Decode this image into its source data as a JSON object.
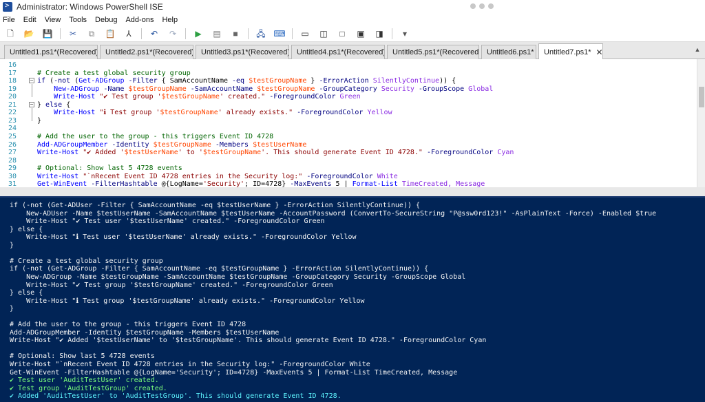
{
  "window": {
    "title": "Administrator: Windows PowerShell ISE"
  },
  "menu": [
    "File",
    "Edit",
    "View",
    "Tools",
    "Debug",
    "Add-ons",
    "Help"
  ],
  "toolbar": {
    "buttons": [
      {
        "name": "new-icon",
        "glyph": "🗋",
        "color": "#2a2a2a"
      },
      {
        "name": "open-icon",
        "glyph": "📂",
        "color": "#c99a2e"
      },
      {
        "name": "save-icon",
        "glyph": "💾",
        "color": "#1f4e9c"
      },
      {
        "name": "cut-icon",
        "glyph": "✂",
        "color": "#3a5fa8"
      },
      {
        "name": "copy-icon",
        "glyph": "⧉",
        "color": "#888888"
      },
      {
        "name": "paste-icon",
        "glyph": "📋",
        "color": "#555555"
      },
      {
        "name": "clear-icon",
        "glyph": "⅄",
        "color": "#2a2a2a"
      },
      {
        "name": "undo-icon",
        "glyph": "↶",
        "color": "#1f4e9c"
      },
      {
        "name": "redo-icon",
        "glyph": "↷",
        "color": "#9aa7bd"
      },
      {
        "name": "run-icon",
        "glyph": "▶",
        "color": "#2ea043"
      },
      {
        "name": "run-selection-icon",
        "glyph": "▤",
        "color": "#777777"
      },
      {
        "name": "stop-icon",
        "glyph": "■",
        "color": "#666666"
      },
      {
        "name": "remote-icon",
        "glyph": "🖧",
        "color": "#1f4e9c"
      },
      {
        "name": "powershell-icon",
        "glyph": "⌨",
        "color": "#2e6cc2"
      },
      {
        "name": "layout-top-icon",
        "glyph": "▭",
        "color": "#333333"
      },
      {
        "name": "layout-right-icon",
        "glyph": "◫",
        "color": "#333333"
      },
      {
        "name": "layout-max-icon",
        "glyph": "□",
        "color": "#333333"
      },
      {
        "name": "show-script-icon",
        "glyph": "▣",
        "color": "#333333"
      },
      {
        "name": "show-commands-icon",
        "glyph": "◨",
        "color": "#333333"
      },
      {
        "name": "overflow-icon",
        "glyph": "▾",
        "color": "#555555"
      }
    ]
  },
  "tabs": [
    {
      "label": "Untitled1.ps1*(Recovered)",
      "active": false
    },
    {
      "label": "Untitled2.ps1*(Recovered)",
      "active": false
    },
    {
      "label": "Untitled3.ps1*(Recovered)",
      "active": false
    },
    {
      "label": "Untitled4.ps1*(Recovered)",
      "active": false
    },
    {
      "label": "Untitled5.ps1*(Recovered)",
      "active": false
    },
    {
      "label": "Untitled6.ps1*",
      "active": false
    },
    {
      "label": "Untitled7.ps1*",
      "active": true
    }
  ],
  "tab_close_glyph": "✕",
  "editor": {
    "lines": [
      {
        "n": "16",
        "tokens": []
      },
      {
        "n": "17",
        "tokens": [
          [
            "c-comment",
            "# Create a test global security group"
          ]
        ]
      },
      {
        "n": "18",
        "fold": "−",
        "tokens": [
          [
            "c-kw",
            "if"
          ],
          [
            "c-plain",
            " ("
          ],
          [
            "c-param",
            "-not"
          ],
          [
            "c-plain",
            " ("
          ],
          [
            "c-cmd",
            "Get-ADGroup"
          ],
          [
            "c-param",
            " -Filter"
          ],
          [
            "c-plain",
            " { SamAccountName "
          ],
          [
            "c-param",
            "-eq"
          ],
          [
            "c-var",
            " $testGroupName"
          ],
          [
            "c-plain",
            " } "
          ],
          [
            "c-param",
            "-ErrorAction"
          ],
          [
            "c-attr",
            " SilentlyContinue"
          ],
          [
            "c-plain",
            ")) {"
          ]
        ]
      },
      {
        "n": "19",
        "tokens": [
          [
            "c-plain",
            "    "
          ],
          [
            "c-cmd",
            "New-ADGroup"
          ],
          [
            "c-param",
            " -Name"
          ],
          [
            "c-var",
            " $testGroupName"
          ],
          [
            "c-param",
            " -SamAccountName"
          ],
          [
            "c-var",
            " $testGroupName"
          ],
          [
            "c-param",
            " -GroupCategory"
          ],
          [
            "c-attr",
            " Security"
          ],
          [
            "c-param",
            " -GroupScope"
          ],
          [
            "c-attr",
            " Global"
          ]
        ]
      },
      {
        "n": "20",
        "tokens": [
          [
            "c-plain",
            "    "
          ],
          [
            "c-cmd",
            "Write-Host"
          ],
          [
            "c-str",
            " \"✔ Test group '"
          ],
          [
            "c-var",
            "$testGroupName"
          ],
          [
            "c-str",
            "' created.\""
          ],
          [
            "c-param",
            " -ForegroundColor"
          ],
          [
            "c-attr",
            " Green"
          ]
        ]
      },
      {
        "n": "21",
        "fold": "−",
        "tokens": [
          [
            "c-plain",
            "} "
          ],
          [
            "c-kw",
            "else"
          ],
          [
            "c-plain",
            " {"
          ]
        ]
      },
      {
        "n": "22",
        "tokens": [
          [
            "c-plain",
            "    "
          ],
          [
            "c-cmd",
            "Write-Host"
          ],
          [
            "c-str",
            " \"ℹ Test group '"
          ],
          [
            "c-var",
            "$testGroupName"
          ],
          [
            "c-str",
            "' already exists.\""
          ],
          [
            "c-param",
            " -ForegroundColor"
          ],
          [
            "c-attr",
            " Yellow"
          ]
        ]
      },
      {
        "n": "23",
        "tokens": [
          [
            "c-plain",
            "}"
          ]
        ]
      },
      {
        "n": "24",
        "tokens": []
      },
      {
        "n": "25",
        "tokens": [
          [
            "c-comment",
            "# Add the user to the group - this triggers Event ID 4728"
          ]
        ]
      },
      {
        "n": "26",
        "tokens": [
          [
            "c-cmd",
            "Add-ADGroupMember"
          ],
          [
            "c-param",
            " -Identity"
          ],
          [
            "c-var",
            " $testGroupName"
          ],
          [
            "c-param",
            " -Members"
          ],
          [
            "c-var",
            " $testUserName"
          ]
        ]
      },
      {
        "n": "27",
        "tokens": [
          [
            "c-cmd",
            "Write-Host"
          ],
          [
            "c-str",
            " \"✔ Added '"
          ],
          [
            "c-var",
            "$testUserName"
          ],
          [
            "c-str",
            "' to '"
          ],
          [
            "c-var",
            "$testGroupName"
          ],
          [
            "c-str",
            "'. This should generate Event ID 4728.\""
          ],
          [
            "c-param",
            " -ForegroundColor"
          ],
          [
            "c-attr",
            " Cyan"
          ]
        ]
      },
      {
        "n": "28",
        "tokens": []
      },
      {
        "n": "29",
        "tokens": [
          [
            "c-comment",
            "# Optional: Show last 5 4728 events"
          ]
        ]
      },
      {
        "n": "30",
        "tokens": [
          [
            "c-cmd",
            "Write-Host"
          ],
          [
            "c-str",
            " \"`nRecent Event ID 4728 entries in the Security log:\""
          ],
          [
            "c-param",
            " -ForegroundColor"
          ],
          [
            "c-attr",
            " White"
          ]
        ]
      },
      {
        "n": "31",
        "tokens": [
          [
            "c-cmd",
            "Get-WinEvent"
          ],
          [
            "c-param",
            " -FilterHashtable"
          ],
          [
            "c-plain",
            " @{LogName="
          ],
          [
            "c-str",
            "'Security'"
          ],
          [
            "c-plain",
            "; ID=4728}"
          ],
          [
            "c-param",
            " -MaxEvents"
          ],
          [
            "c-plain",
            " 5 | "
          ],
          [
            "c-cmd",
            "Format-List"
          ],
          [
            "c-attr",
            " TimeCreated, Message"
          ]
        ]
      }
    ]
  },
  "console": {
    "lines": [
      {
        "cls": "",
        "text": "if (-not (Get-ADUser -Filter { SamAccountName -eq $testUserName } -ErrorAction SilentlyContinue)) {"
      },
      {
        "cls": "",
        "text": "    New-ADUser -Name $testUserName -SamAccountName $testUserName -AccountPassword (ConvertTo-SecureString \"P@ssw0rd123!\" -AsPlainText -Force) -Enabled $true"
      },
      {
        "cls": "",
        "text": "    Write-Host \"✔ Test user '$testUserName' created.\" -ForegroundColor Green"
      },
      {
        "cls": "",
        "text": "} else {"
      },
      {
        "cls": "",
        "text": "    Write-Host \"ℹ Test user '$testUserName' already exists.\" -ForegroundColor Yellow"
      },
      {
        "cls": "",
        "text": "}"
      },
      {
        "cls": "",
        "text": ""
      },
      {
        "cls": "",
        "text": "# Create a test global security group"
      },
      {
        "cls": "",
        "text": "if (-not (Get-ADGroup -Filter { SamAccountName -eq $testGroupName } -ErrorAction SilentlyContinue)) {"
      },
      {
        "cls": "",
        "text": "    New-ADGroup -Name $testGroupName -SamAccountName $testGroupName -GroupCategory Security -GroupScope Global"
      },
      {
        "cls": "",
        "text": "    Write-Host \"✔ Test group '$testGroupName' created.\" -ForegroundColor Green"
      },
      {
        "cls": "",
        "text": "} else {"
      },
      {
        "cls": "",
        "text": "    Write-Host \"ℹ Test group '$testGroupName' already exists.\" -ForegroundColor Yellow"
      },
      {
        "cls": "",
        "text": "}"
      },
      {
        "cls": "",
        "text": ""
      },
      {
        "cls": "",
        "text": "# Add the user to the group - this triggers Event ID 4728"
      },
      {
        "cls": "",
        "text": "Add-ADGroupMember -Identity $testGroupName -Members $testUserName"
      },
      {
        "cls": "",
        "text": "Write-Host \"✔ Added '$testUserName' to '$testGroupName'. This should generate Event ID 4728.\" -ForegroundColor Cyan"
      },
      {
        "cls": "",
        "text": ""
      },
      {
        "cls": "",
        "text": "# Optional: Show last 5 4728 events"
      },
      {
        "cls": "",
        "text": "Write-Host \"`nRecent Event ID 4728 entries in the Security log:\" -ForegroundColor White"
      },
      {
        "cls": "",
        "text": "Get-WinEvent -FilterHashtable @{LogName='Security'; ID=4728} -MaxEvents 5 | Format-List TimeCreated, Message"
      },
      {
        "cls": "green",
        "text": "✔ Test user 'AuditTestUser' created."
      },
      {
        "cls": "green",
        "text": "✔ Test group 'AuditTestGroup' created."
      },
      {
        "cls": "cyan",
        "text": "✔ Added 'AuditTestUser' to 'AuditTestGroup'. This should generate Event ID 4728."
      }
    ]
  }
}
